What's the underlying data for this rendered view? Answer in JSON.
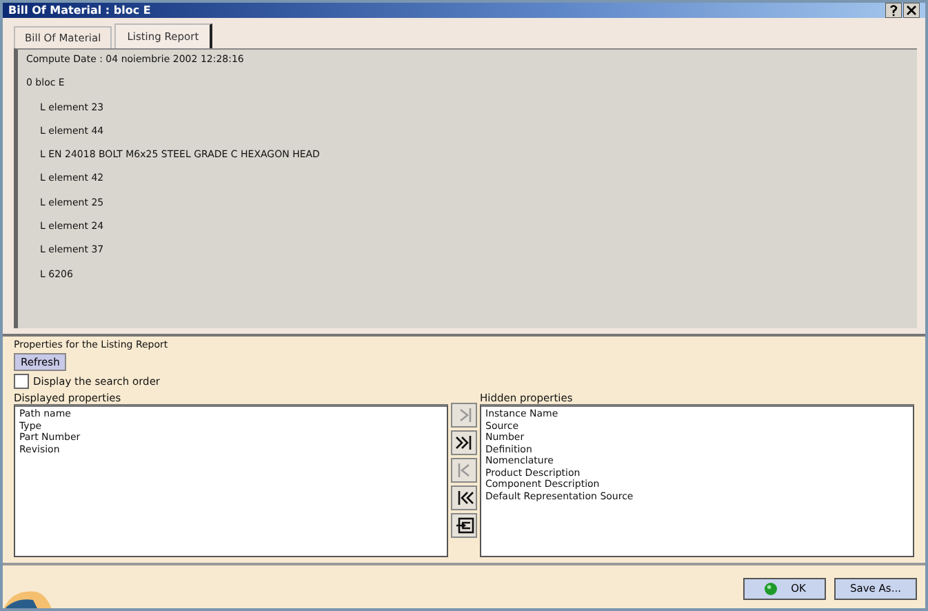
{
  "window": {
    "title": "Bill Of Material : bloc E"
  },
  "tabs": [
    {
      "label": "Bill Of Material",
      "selected": false
    },
    {
      "label": "Listing Report",
      "selected": true
    }
  ],
  "report": {
    "compute_date": "Compute Date : 04 noiembrie 2002 12:28:16",
    "tree": [
      {
        "label": "0 bloc E",
        "children": [
          {
            "label": "L element 23"
          },
          {
            "label": "L element 44"
          },
          {
            "label": "L EN 24018 BOLT M6x25 STEEL GRADE C HEXAGON HEAD"
          },
          {
            "label": "L element 42"
          },
          {
            "label": "L element 25"
          },
          {
            "label": "L element 24"
          },
          {
            "label": "L element 37"
          },
          {
            "label": "L 6206"
          }
        ]
      }
    ]
  },
  "properties": {
    "legend": "Properties for the Listing Report",
    "refresh": "Refresh",
    "search_order": {
      "label": "Display the search order",
      "checked": false
    },
    "displayed": {
      "label": "Displayed properties",
      "items": [
        "Path name",
        "Type",
        "Part Number",
        "Revision"
      ]
    },
    "transfer_buttons": [
      {
        "kind": "move-one",
        "disabled": true
      },
      {
        "kind": "move-all",
        "disabled": false
      },
      {
        "kind": "back-one",
        "disabled": true
      },
      {
        "kind": "back-all",
        "disabled": false
      },
      {
        "kind": "insert",
        "disabled": false
      }
    ],
    "hidden": {
      "label": "Hidden properties",
      "items": [
        "Instance Name",
        "Source",
        "Number",
        "Definition",
        "Nomenclature",
        "Product Description",
        "Component Description",
        "Default Representation Source"
      ]
    }
  },
  "buttons": [
    {
      "kind": "ok",
      "label": "OK"
    },
    {
      "kind": "plain",
      "label": "Save As..."
    }
  ]
}
